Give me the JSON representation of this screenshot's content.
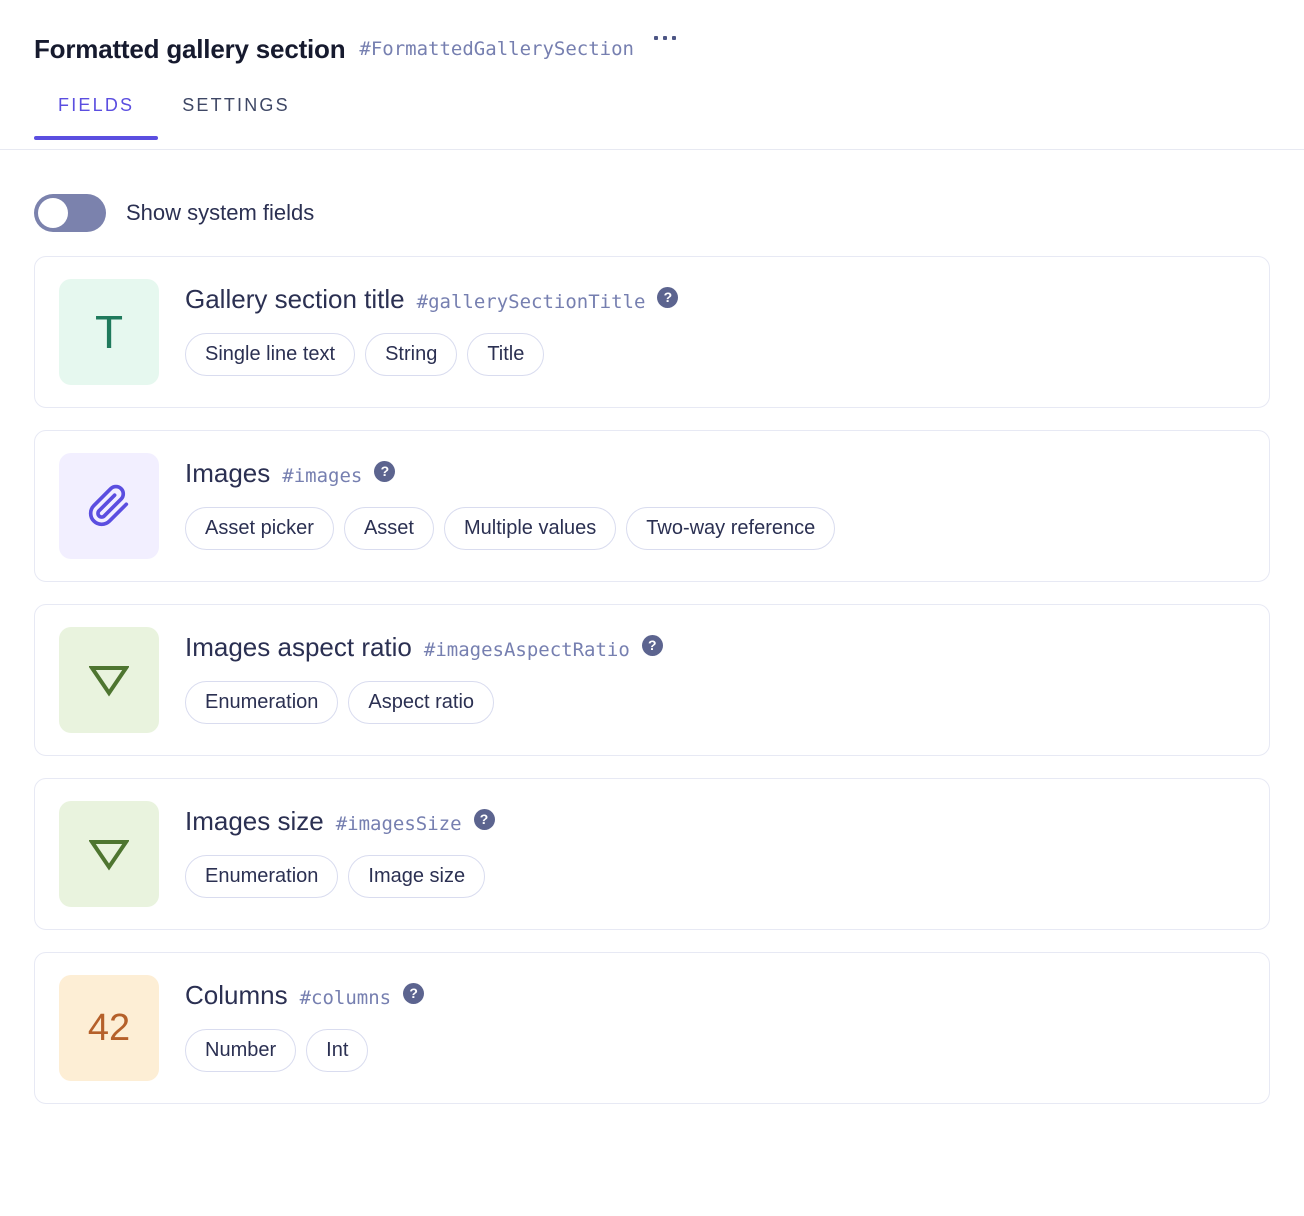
{
  "header": {
    "title": "Formatted gallery section",
    "api_id": "#FormattedGallerySection",
    "menu_icon": "ellipsis-icon"
  },
  "tabs": [
    {
      "label": "FIELDS",
      "active": true
    },
    {
      "label": "SETTINGS",
      "active": false
    }
  ],
  "toggle": {
    "label": "Show system fields",
    "state": "off"
  },
  "colors": {
    "accent": "#5b4ee0",
    "text": "#2b3052",
    "api_id": "#767fb0",
    "card_border": "#e7e9f4",
    "pill_border": "#d9dcef",
    "help_badge": "#5c648f",
    "toggle_track_off": "#7b82ad"
  },
  "help_glyph": "?",
  "fields": [
    {
      "name": "Gallery section title",
      "api_id": "#gallerySectionTitle",
      "icon": {
        "kind": "text",
        "name": "text-field-icon",
        "glyph": "T"
      },
      "tags": [
        "Single line text",
        "String",
        "Title"
      ]
    },
    {
      "name": "Images",
      "api_id": "#images",
      "icon": {
        "kind": "asset",
        "name": "paperclip-icon",
        "glyph": ""
      },
      "tags": [
        "Asset picker",
        "Asset",
        "Multiple values",
        "Two-way reference"
      ]
    },
    {
      "name": "Images aspect ratio",
      "api_id": "#imagesAspectRatio",
      "icon": {
        "kind": "enum",
        "name": "enumeration-triangle-icon",
        "glyph": ""
      },
      "tags": [
        "Enumeration",
        "Aspect ratio"
      ]
    },
    {
      "name": "Images size",
      "api_id": "#imagesSize",
      "icon": {
        "kind": "enum",
        "name": "enumeration-triangle-icon",
        "glyph": ""
      },
      "tags": [
        "Enumeration",
        "Image size"
      ]
    },
    {
      "name": "Columns",
      "api_id": "#columns",
      "icon": {
        "kind": "number",
        "name": "number-field-icon",
        "glyph": "42"
      },
      "tags": [
        "Number",
        "Int"
      ]
    }
  ]
}
